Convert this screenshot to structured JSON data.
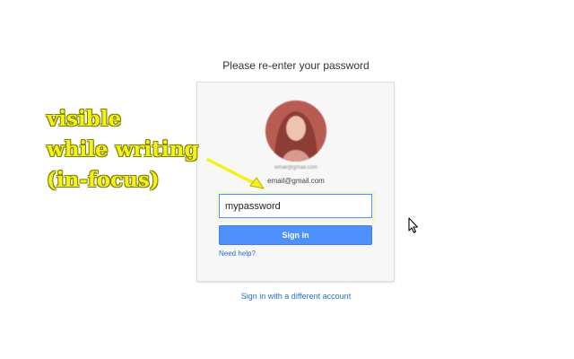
{
  "header": {
    "title": "Please re-enter your password"
  },
  "account": {
    "email_small": "email@gmail.com",
    "email": "email@gmail.com"
  },
  "form": {
    "password_value": "mypassword",
    "signin_label": "Sign in",
    "need_help_label": "Need help?"
  },
  "footer": {
    "different_account_label": "Sign in with a different account"
  },
  "annotation": {
    "lines": [
      "visible",
      "while writing",
      "(in-focus)"
    ]
  },
  "icons": {
    "cursor": "mouse-cursor-icon",
    "arrow": "arrow-icon"
  },
  "colors": {
    "accent": "#4d90fe",
    "link": "#2a6fc9",
    "annotation": "#f3f11a"
  }
}
